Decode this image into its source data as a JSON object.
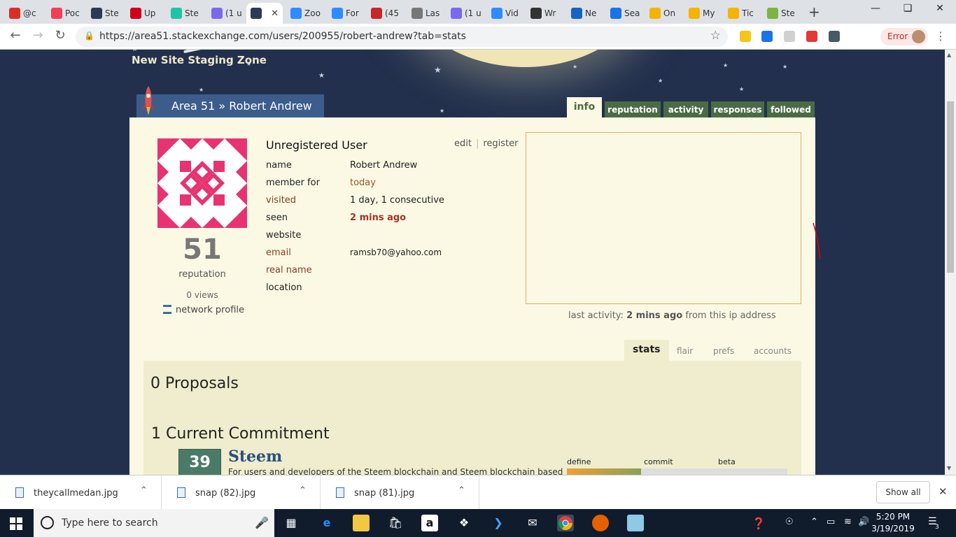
{
  "browser": {
    "tabs": [
      {
        "label": "@c",
        "icon": "calendar-icon",
        "color": "#d93025"
      },
      {
        "label": "Poc",
        "icon": "pocket-icon",
        "color": "#ef4056"
      },
      {
        "label": "Ste",
        "icon": "area51-icon",
        "color": "#2b3a55"
      },
      {
        "label": "Up",
        "icon": "upwork-icon",
        "color": "#d0021b"
      },
      {
        "label": "Ste",
        "icon": "steemit-icon",
        "color": "#1cc6a5"
      },
      {
        "label": "(1 u",
        "icon": "mail-icon",
        "color": "#7b68ee"
      },
      {
        "label": "",
        "icon": "area51-icon",
        "color": "#2b3a55"
      },
      {
        "label": "Zoo",
        "icon": "zoom-icon",
        "color": "#2d8cff"
      },
      {
        "label": "For",
        "icon": "zoom-icon",
        "color": "#2d8cff"
      },
      {
        "label": "(45",
        "icon": "w-icon",
        "color": "#c62828"
      },
      {
        "label": "Las",
        "icon": "doc-icon",
        "color": "#777777"
      },
      {
        "label": "(1 u",
        "icon": "mail-icon",
        "color": "#7b68ee"
      },
      {
        "label": "Vid",
        "icon": "zoom-icon",
        "color": "#2d8cff"
      },
      {
        "label": "Wr",
        "icon": "bolt-icon",
        "color": "#333333"
      },
      {
        "label": "Ne",
        "icon": "flag-icon",
        "color": "#1565c0"
      },
      {
        "label": "Sea",
        "icon": "search-site-icon",
        "color": "#1a73e8"
      },
      {
        "label": "On",
        "icon": "app-icon",
        "color": "#f4b400"
      },
      {
        "label": "My",
        "icon": "app-icon",
        "color": "#f4b400"
      },
      {
        "label": "Tic",
        "icon": "app-icon",
        "color": "#f4b400"
      },
      {
        "label": "Ste",
        "icon": "android-icon",
        "color": "#7cb342"
      }
    ],
    "url": "https://area51.stackexchange.com/users/200955/robert-andrew?tab=stats",
    "error_label": "Error"
  },
  "page": {
    "staging": "New Site Staging Zone",
    "breadcrumb": "Area 51 » Robert Andrew",
    "user_tabs": [
      "info",
      "reputation",
      "activity",
      "responses",
      "followed"
    ],
    "active_user_tab": "info",
    "user_title": "Unregistered User",
    "edit": "edit",
    "register": "register",
    "reputation": "51",
    "reputation_label": "reputation",
    "views": "0 views",
    "network_profile": "network profile",
    "fields": [
      {
        "key": "name",
        "value": "Robert Andrew"
      },
      {
        "key": "member for",
        "value": "today"
      },
      {
        "key": "visited",
        "value": "1 day, 1 consecutive"
      },
      {
        "key": "seen",
        "value": "2 mins ago"
      },
      {
        "key": "website",
        "value": ""
      },
      {
        "key": "email",
        "value": "ramsb70@yahoo.com"
      },
      {
        "key": "real name",
        "value": ""
      },
      {
        "key": "location",
        "value": ""
      }
    ],
    "last_activity_prefix": "last activity:",
    "last_activity_time": "2 mins ago",
    "last_activity_suffix": "from this ip address",
    "stat_tabs": [
      "stats",
      "flair",
      "prefs",
      "accounts"
    ],
    "active_stat_tab": "stats",
    "proposals_heading": "0 Proposals",
    "commitments_heading": "1 Current Commitment",
    "commitment": {
      "score": "39",
      "site": "Steem",
      "description": "For users and developers of the Steem blockchain and Steem blockchain based",
      "phases": [
        "define",
        "commit",
        "beta"
      ]
    }
  },
  "downloads": [
    {
      "file": "theycallmedan.jpg"
    },
    {
      "file": "snap (82).jpg"
    },
    {
      "file": "snap (81).jpg"
    }
  ],
  "downloads_show_all": "Show all",
  "taskbar": {
    "search_placeholder": "Type here to search",
    "time": "5:20 PM",
    "date": "3/19/2019",
    "notification_count": "3"
  }
}
